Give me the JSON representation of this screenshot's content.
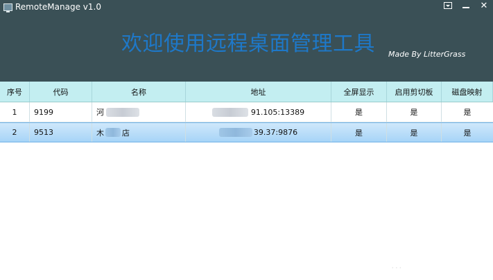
{
  "window": {
    "title": "RemoteManage v1.0",
    "headline": "欢迎使用远程桌面管理工具",
    "credit": "Made By LitterGrass",
    "controls": {
      "menu": "▾",
      "close": "✕"
    }
  },
  "table": {
    "columns": [
      "序号",
      "代码",
      "名称",
      "地址",
      "全屏显示",
      "启用剪切板",
      "磁盘映射"
    ],
    "rows": [
      {
        "index": "1",
        "code": "9199",
        "name": "河",
        "address": "91.105:13389",
        "fullscreen": "是",
        "clipboard": "是",
        "disk": "是"
      },
      {
        "index": "2",
        "code": "9513",
        "name_start": "木",
        "name_end": "店",
        "address": "39.37:9876",
        "fullscreen": "是",
        "clipboard": "是",
        "disk": "是"
      }
    ]
  },
  "watermark": "..."
}
